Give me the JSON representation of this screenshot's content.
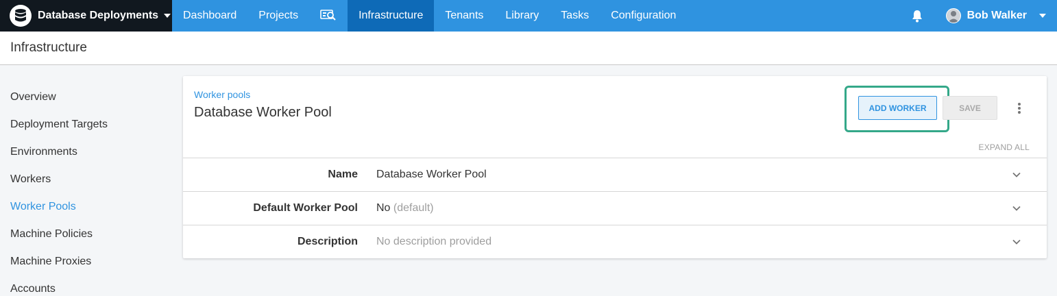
{
  "nav": {
    "space_name": "Database Deployments",
    "items": [
      {
        "label": "Dashboard"
      },
      {
        "label": "Projects"
      },
      {
        "label": "Infrastructure",
        "active": true
      },
      {
        "label": "Tenants"
      },
      {
        "label": "Library"
      },
      {
        "label": "Tasks"
      },
      {
        "label": "Configuration"
      }
    ],
    "user_name": "Bob Walker",
    "icons": [
      "database-icon",
      "search-icon",
      "bell-icon",
      "avatar",
      "chevron-down-icon"
    ]
  },
  "page": {
    "title": "Infrastructure"
  },
  "sidebar": {
    "items": [
      {
        "label": "Overview"
      },
      {
        "label": "Deployment Targets"
      },
      {
        "label": "Environments"
      },
      {
        "label": "Workers"
      },
      {
        "label": "Worker Pools",
        "active": true
      },
      {
        "label": "Machine Policies"
      },
      {
        "label": "Machine Proxies"
      },
      {
        "label": "Accounts"
      }
    ]
  },
  "card": {
    "breadcrumb": "Worker pools",
    "title": "Database Worker Pool",
    "add_worker_label": "ADD WORKER",
    "save_label": "SAVE",
    "expand_all_label": "EXPAND ALL",
    "fields": [
      {
        "label": "Name",
        "value": "Database Worker Pool",
        "note": ""
      },
      {
        "label": "Default Worker Pool",
        "value": "No",
        "note": "(default)"
      },
      {
        "label": "Description",
        "value": "",
        "note": "No description provided"
      }
    ]
  },
  "colors": {
    "nav_blue": "#2f93e0",
    "nav_active": "#0e6ab7",
    "space_bg": "#11181f",
    "highlight_green": "#34a889"
  }
}
